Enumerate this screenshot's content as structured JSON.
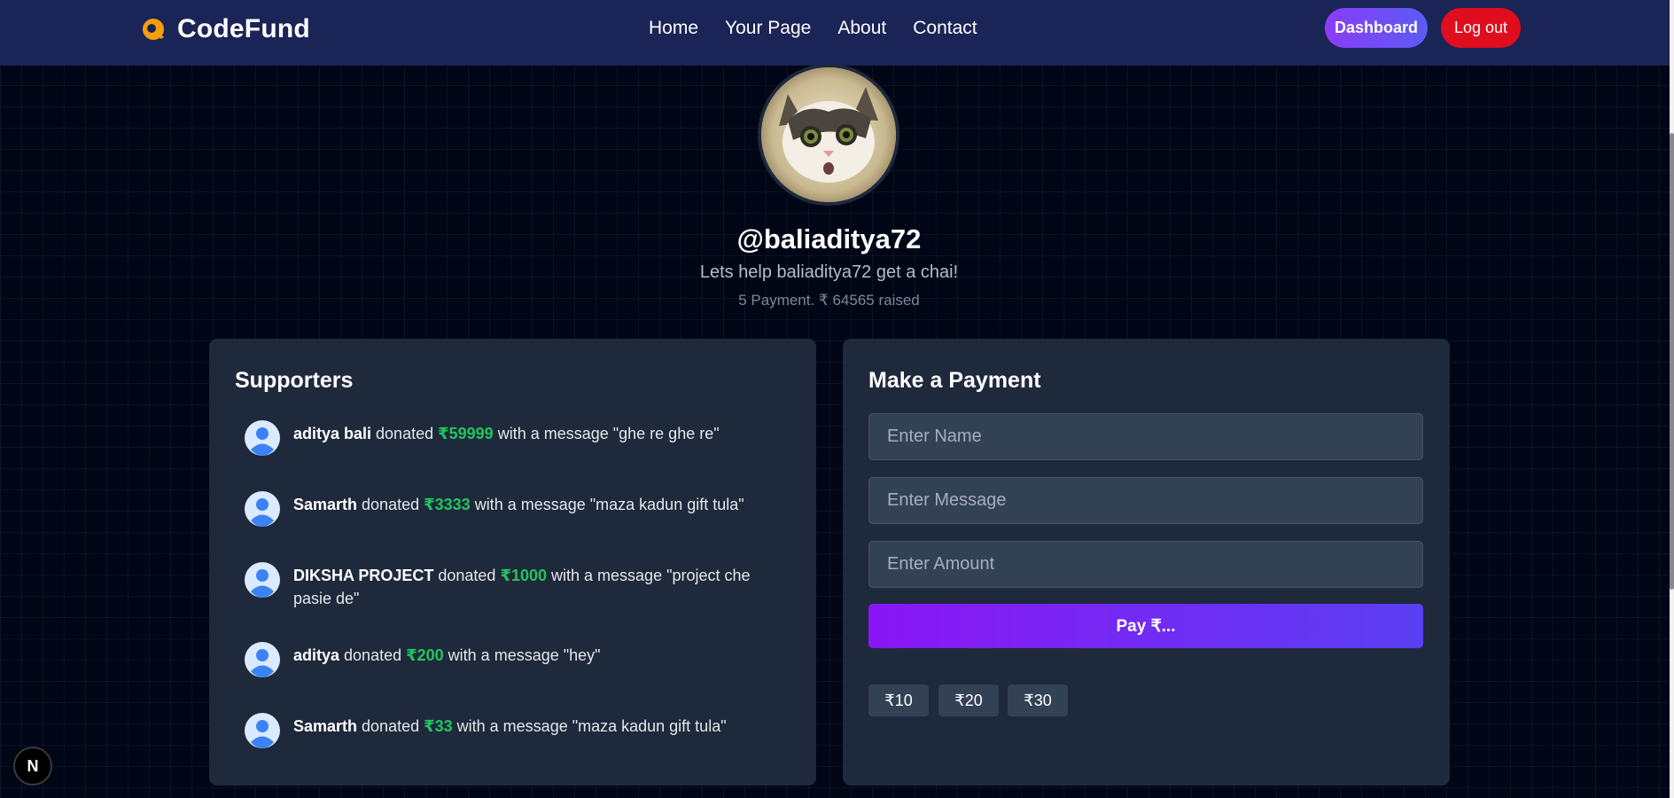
{
  "brand": {
    "name": "CodeFund",
    "accent": "#f59e0b"
  },
  "nav": {
    "links": [
      "Home",
      "Your Page",
      "About",
      "Contact"
    ]
  },
  "header_actions": {
    "dashboard": "Dashboard",
    "logout": "Log out"
  },
  "profile": {
    "username": "@baliaditya72",
    "tagline": "Lets help baliaditya72 get a chai!",
    "stats": "5 Payment. ₹ 64565 raised"
  },
  "supporters": {
    "title": "Supporters",
    "items": [
      {
        "name": "aditya bali",
        "donated": " donated ",
        "amount": "₹59999",
        "with_message": " with a message ",
        "message": "\"ghe re ghe re\""
      },
      {
        "name": "Samarth",
        "donated": " donated ",
        "amount": "₹3333",
        "with_message": " with a message ",
        "message": "\"maza kadun gift tula\""
      },
      {
        "name": "DIKSHA PROJECT",
        "donated": " donated ",
        "amount": "₹1000",
        "with_message": " with a message ",
        "message": "\"project che pasie de\""
      },
      {
        "name": "aditya",
        "donated": " donated ",
        "amount": "₹200",
        "with_message": " with a message ",
        "message": "\"hey\""
      },
      {
        "name": "Samarth",
        "donated": " donated ",
        "amount": "₹33",
        "with_message": " with a message ",
        "message": "\"maza kadun gift tula\""
      }
    ]
  },
  "payment": {
    "title": "Make a Payment",
    "name_placeholder": "Enter Name",
    "message_placeholder": "Enter Message",
    "amount_placeholder": "Enter Amount",
    "pay_label": "Pay ₹...",
    "quick_amounts": [
      "₹10",
      "₹20",
      "₹30"
    ]
  },
  "badge": {
    "letter": "N"
  },
  "colors": {
    "navbar": "#1a2456",
    "card": "#1e293b",
    "amount_green": "#22c55e",
    "logout_red": "#e00d1e"
  }
}
